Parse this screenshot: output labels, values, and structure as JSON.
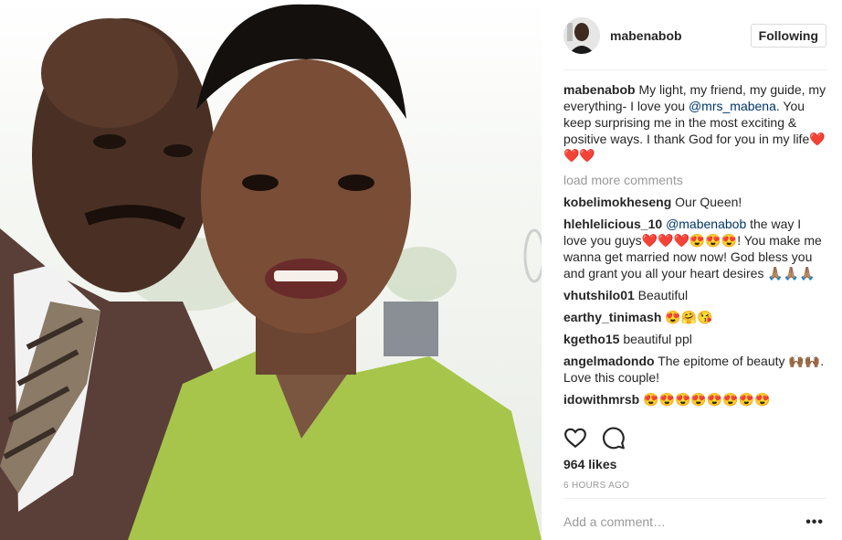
{
  "post": {
    "username": "mabenabob",
    "follow_label": "Following"
  },
  "caption": {
    "user": "mabenabob",
    "text_before": " My light, my friend, my guide, my everything- I love you ",
    "mention": "@mrs_mabena",
    "text_after": ". You keep surprising me in the most exciting & positive ways. I thank God for you in my life",
    "emoji": "❤️❤️❤️"
  },
  "load_more": "load more comments",
  "comments": [
    {
      "user": "kobelimokheseng",
      "text": " Our Queen!"
    },
    {
      "user": "hlehlelicious_10",
      "mention": "@mabenabob",
      "text": " the way I love you guys❤️❤️❤️😍😍😍! You make me wanna get married now now! God bless you and grant you all your heart desires 🙏🏽🙏🏽🙏🏽"
    },
    {
      "user": "vhutshilo01",
      "text": " Beautiful"
    },
    {
      "user": "earthy_tinimash",
      "text": " 😍🤗😘"
    },
    {
      "user": "kgetho15",
      "text": " beautiful ppl"
    },
    {
      "user": "angelmadondo",
      "text": " The epitome of beauty 🙌🏾🙌🏾. Love this couple!"
    },
    {
      "user": "idowithmrsb",
      "text": " 😍😍😍😍😍😍😍😍"
    }
  ],
  "likes": "964 likes",
  "time": "6 HOURS AGO",
  "add_comment_placeholder": "Add a comment…",
  "more_options": "•••",
  "icons": {
    "like": "heart-icon",
    "comment": "comment-icon",
    "options": "more-options-icon"
  }
}
